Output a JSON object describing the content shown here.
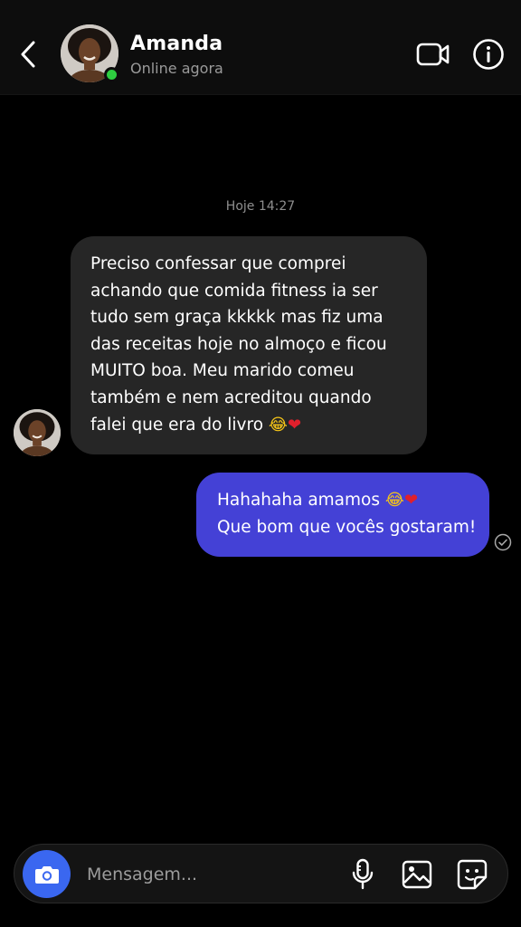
{
  "header": {
    "contact_name": "Amanda",
    "status_text": "Online agora",
    "online_color": "#2ecc40",
    "icons": {
      "back": "chevron-left-icon",
      "video": "video-camera-icon",
      "info": "info-icon"
    }
  },
  "conversation": {
    "timestamp": "Hoje 14:27",
    "incoming": {
      "lines": [
        "Preciso confessar que comprei",
        "achando que comida fitness ia ser",
        "tudo sem graça kkkkk mas fiz uma",
        "das receitas hoje no almoço e ficou",
        "MUITO boa. Meu marido comeu",
        "também e nem acreditou quando",
        "falei que era do livro"
      ],
      "emojis": [
        "😂",
        "❤"
      ]
    },
    "outgoing": {
      "lines": [
        "Hahahaha amamos",
        "Que bom que vocês gostaram!"
      ],
      "emojis": [
        "😂",
        "❤"
      ],
      "seen_icon": "check-circle-icon"
    }
  },
  "composer": {
    "placeholder": "Mensagem...",
    "icons": {
      "camera": "camera-icon",
      "mic": "microphone-icon",
      "gallery": "image-icon",
      "sticker": "sticker-icon"
    }
  },
  "colors": {
    "background": "#000000",
    "incoming_bubble": "#262626",
    "outgoing_bubble": "#4441d6",
    "camera_button": "#3a67f0"
  }
}
